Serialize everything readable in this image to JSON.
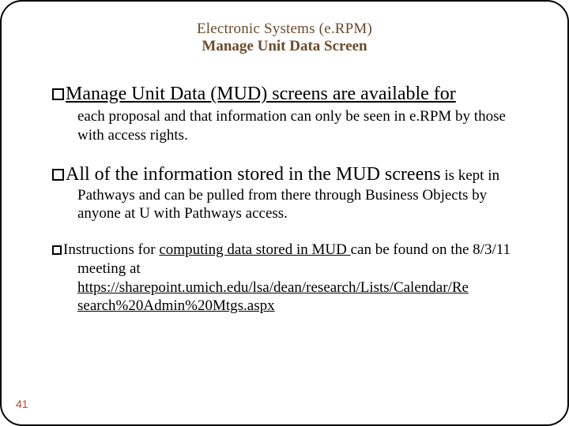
{
  "header": {
    "line1": "Electronic Systems (e.RPM)",
    "line2": "Manage Unit Data Screen"
  },
  "bullets": {
    "b1": {
      "lead": "Manage Unit Data (MUD) screens are available for",
      "rest": " each proposal and that information can only be seen in e.RPM by those with access rights."
    },
    "b2": {
      "lead": "All of the information stored in the MUD screens",
      "rest_a": " is kept in Pathways and can be pulled from there through Business Objects by anyone at U with Pathways access."
    },
    "b3": {
      "pre": "Instructions for ",
      "u1": "computing data stored in MUD ",
      "mid": "can be found on the 8/3/11 meeting at ",
      "link": "https://sharepoint.umich.edu/lsa/dean/research/Lists/Calendar/Research%20Admin%20Mtgs.aspx"
    }
  },
  "page_number": "41"
}
